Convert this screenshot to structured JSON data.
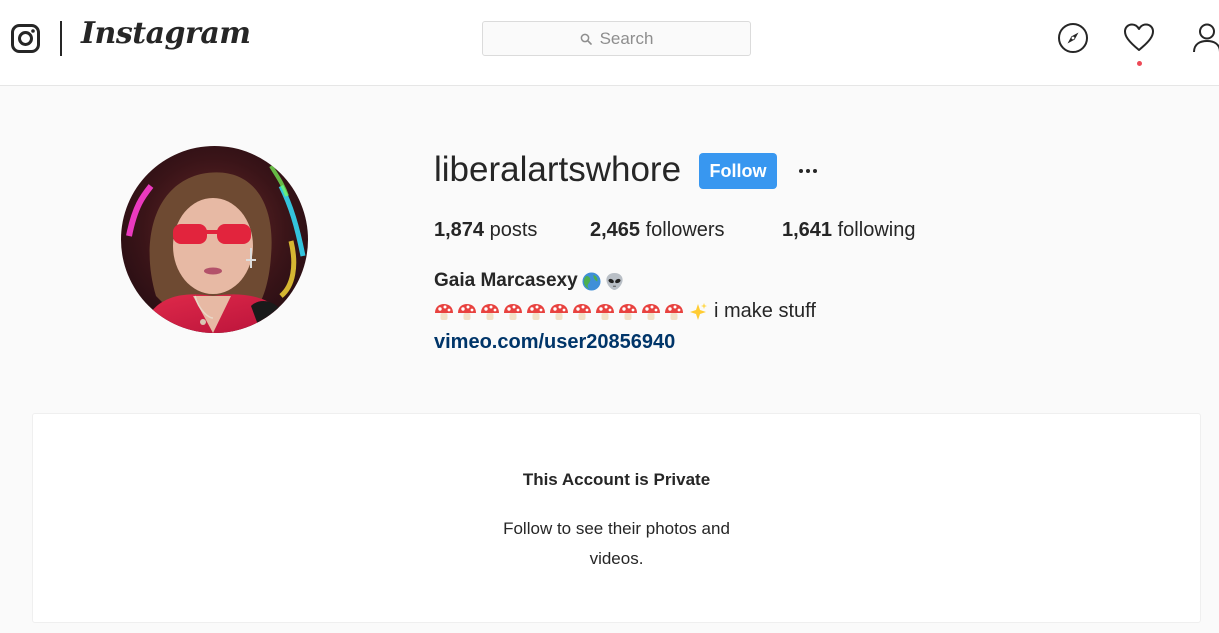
{
  "nav": {
    "brand_name": "Instagram",
    "search_placeholder": "Search",
    "icons": [
      "instagram-glyph-icon",
      "search-icon",
      "compass-icon",
      "heart-icon",
      "person-icon"
    ],
    "notification_dot_color": "#ed4956"
  },
  "profile": {
    "username": "liberalartswhore",
    "follow_label": "Follow",
    "stats": {
      "posts_count": "1,874",
      "posts_label": "posts",
      "followers_count": "2,465",
      "followers_label": "followers",
      "following_count": "1,641",
      "following_label": "following"
    },
    "full_name": "Gaia Marcasexy",
    "name_emojis": [
      "globe-emoji",
      "alien-emoji"
    ],
    "bio_emojis": [
      "mushroom-emoji",
      "mushroom-emoji",
      "mushroom-emoji",
      "mushroom-emoji",
      "mushroom-emoji",
      "mushroom-emoji",
      "mushroom-emoji",
      "mushroom-emoji",
      "mushroom-emoji",
      "mushroom-emoji",
      "mushroom-emoji",
      "sparkles-emoji"
    ],
    "bio_text": "i make stuff",
    "website": "vimeo.com/user20856940"
  },
  "private_notice": {
    "title": "This Account is Private",
    "subtitle": "Follow to see their photos and videos."
  },
  "colors": {
    "accent": "#3897f0",
    "link": "#003569",
    "text": "#262626",
    "muted": "#8e8e8e",
    "background": "#fafafa"
  }
}
